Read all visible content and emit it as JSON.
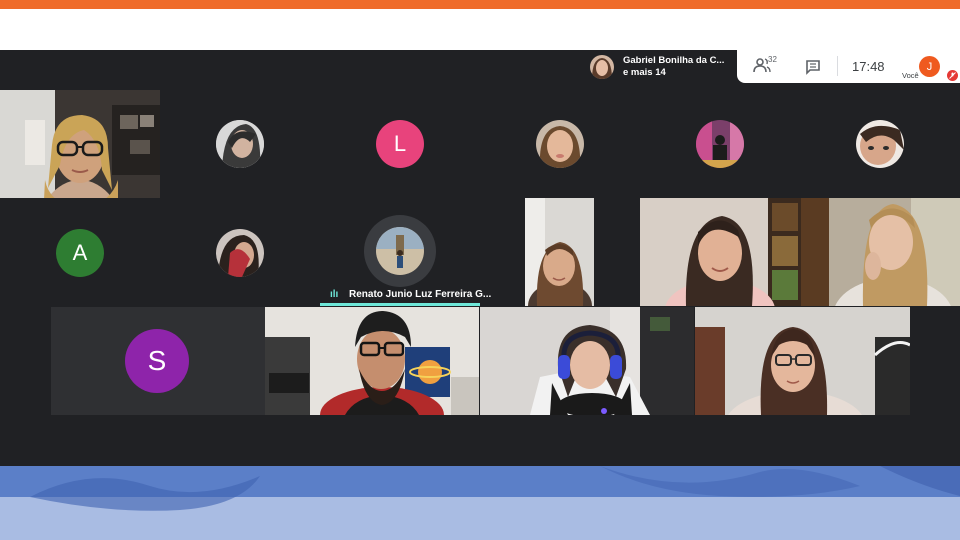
{
  "pinned": {
    "name": "Gabriel Bonilha da C...",
    "sub": "e mais 14"
  },
  "toolbar": {
    "participants_count": "32",
    "time": "17:48",
    "self_initial": "J",
    "self_label": "Você"
  },
  "participants": {
    "l_initial": "L",
    "a_initial": "A",
    "s_initial": "S",
    "speaking_name": "Renato Junio Luz Ferreira G..."
  },
  "colors": {
    "orange": "#ef6c2b",
    "meet_bg": "#202124",
    "tile_bg": "#2b2c30",
    "avatar_l": "#e8437c",
    "avatar_a": "#2e7d32",
    "avatar_s": "#8e24aa",
    "avatar_j": "#ef5a1f",
    "speaking": "#6ee7d8"
  }
}
